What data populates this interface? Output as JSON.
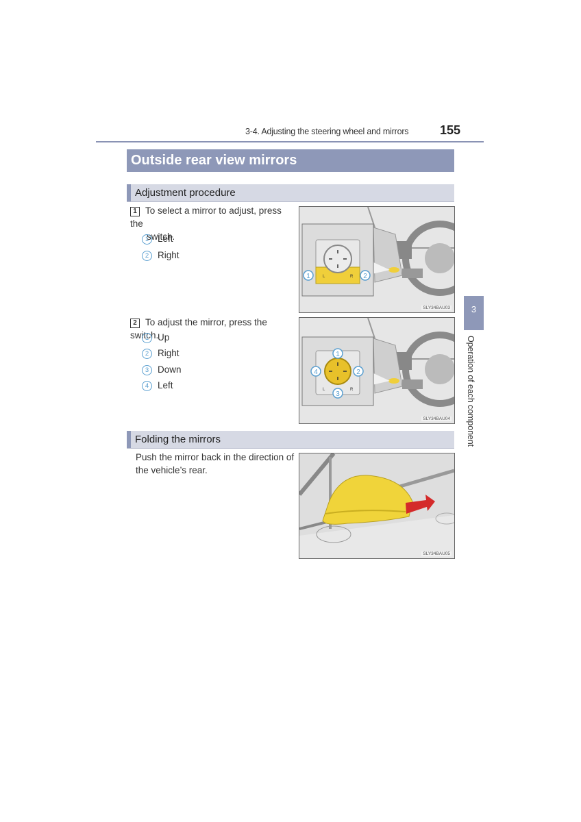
{
  "header": {
    "section": "3-4. Adjusting the steering wheel and mirrors",
    "page_number": "155"
  },
  "main_title": "Outside rear view mirrors",
  "sections": [
    {
      "title": "Adjustment procedure",
      "steps": [
        {
          "number": "1",
          "text_line1": "To select a mirror to adjust, press the",
          "text_line2": "switch.",
          "items": [
            {
              "num": "1",
              "label": "Left"
            },
            {
              "num": "2",
              "label": "Right"
            }
          ],
          "figure": {
            "code": "SLY34BAU03",
            "callouts": [
              "1",
              "2"
            ],
            "switch_labels": [
              "L",
              "R"
            ]
          }
        },
        {
          "number": "2",
          "text_line1": "To adjust the mirror, press the switch.",
          "items": [
            {
              "num": "1",
              "label": "Up"
            },
            {
              "num": "2",
              "label": "Right"
            },
            {
              "num": "3",
              "label": "Down"
            },
            {
              "num": "4",
              "label": "Left"
            }
          ],
          "figure": {
            "code": "SLY34BAU04",
            "callouts": [
              "1",
              "2",
              "3",
              "4"
            ],
            "switch_labels": [
              "L",
              "R"
            ]
          }
        }
      ]
    },
    {
      "title": "Folding the mirrors",
      "paragraph_line1": "Push the mirror back in the direction of",
      "paragraph_line2": "the vehicle’s rear.",
      "figure": {
        "code": "SLY34BAU05"
      }
    }
  ],
  "side_tab": {
    "chapter_number": "3",
    "chapter_label": "Operation of each component"
  },
  "colors": {
    "accent": "#8e98b8",
    "subheader_bg": "#d6d9e4",
    "callout_blue": "#5a9fd0",
    "highlight_yellow": "#f0cf3a",
    "arrow_red": "#d42a2a"
  }
}
